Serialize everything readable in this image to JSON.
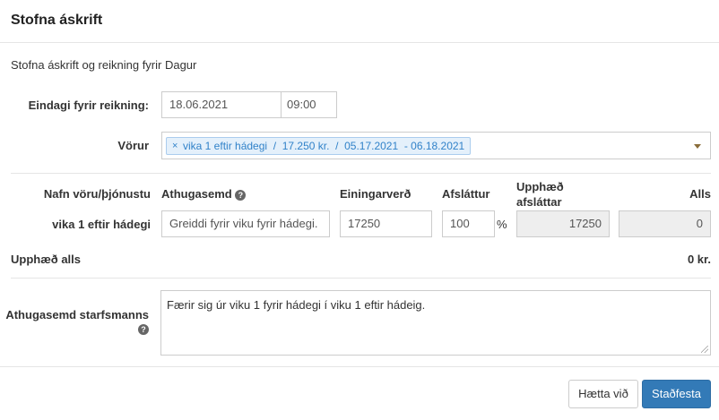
{
  "dialog": {
    "title": "Stofna áskrift",
    "subtitle": "Stofna áskrift og reikning fyrir Dagur"
  },
  "due": {
    "label": "Eindagi fyrir reikning:",
    "date": "18.06.2021",
    "time": "09:00"
  },
  "products": {
    "label": "Vörur",
    "remove_glyph": "×",
    "selected": "vika 1 eftir hádegi  /  17.250 kr.  /  05.17.2021  - 06.18.2021"
  },
  "table": {
    "headers": {
      "name": "Nafn vöru/þjónustu",
      "note": "Athugasemd",
      "unit_price": "Einingarverð",
      "discount": "Afsláttur",
      "discount_amount_line1": "Upphæð",
      "discount_amount_line2": "afsláttar",
      "total": "Alls"
    },
    "row": {
      "name": "vika 1 eftir hádegi",
      "note": "Greiddi fyrir viku fyrir hádegi.",
      "unit_price": "17250",
      "discount": "100",
      "percent": "%",
      "discount_amount": "17250",
      "total": "0"
    }
  },
  "sum": {
    "label": "Upphæð alls",
    "value": "0 kr."
  },
  "staff_note": {
    "label": "Athugasemd starfsmanns",
    "value": "Færir sig úr viku 1 fyrir hádegi í viku 1 eftir hádeig."
  },
  "icons": {
    "help": "question-circle",
    "caret": "caret-down"
  },
  "buttons": {
    "cancel": "Hætta við",
    "confirm": "Staðfesta"
  },
  "colors": {
    "primary": "#337ab7",
    "tag_text": "#3182c9"
  }
}
